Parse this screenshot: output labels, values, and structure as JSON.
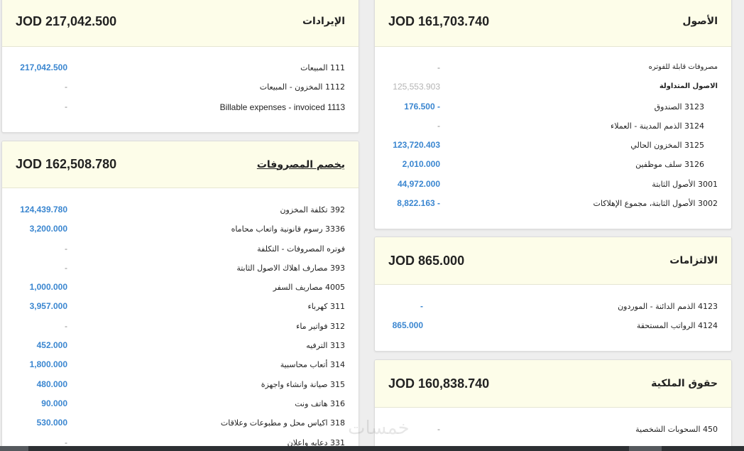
{
  "revenue": {
    "title": "الإيرادات",
    "total": "JOD 217,042.500",
    "rows": [
      {
        "label": "111 المبيعات",
        "value": "217,042.500"
      },
      {
        "label": "1112 المخزون - المبيعات",
        "value": "-"
      },
      {
        "label": "Billable expenses - invoiced 1113",
        "value": "-"
      }
    ]
  },
  "expenses": {
    "title": "يخصم المصروفات",
    "total": "JOD 162,508.780",
    "rows": [
      {
        "label": "392 تكلفة المخزون",
        "value": "124,439.780"
      },
      {
        "label": "3336 رسوم قانونية واتعاب محاماه",
        "value": "3,200.000"
      },
      {
        "label": "فوتره المصروفات - التكلفة",
        "value": "-"
      },
      {
        "label": "393 مصارف اهلاك الاصول الثابتة",
        "value": "-"
      },
      {
        "label": "4005 مصاريف السفر",
        "value": "1,000.000"
      },
      {
        "label": "311 كهرباء",
        "value": "3,957.000"
      },
      {
        "label": "312 فواتير ماء",
        "value": "-"
      },
      {
        "label": "313 الترفيه",
        "value": "452.000"
      },
      {
        "label": "314 أتعاب محاسبية",
        "value": "1,800.000"
      },
      {
        "label": "315 صيانة وانشاء واجهزة",
        "value": "480.000"
      },
      {
        "label": "316 هاتف ونت",
        "value": "90.000"
      },
      {
        "label": "318 اكياس محل و مطبوعات وعلاقات",
        "value": "530.000"
      },
      {
        "label": "331 دعايه واعلان",
        "value": "-"
      }
    ]
  },
  "assets": {
    "title": "الأصول",
    "total": "JOD 161,703.740",
    "rows": [
      {
        "label": "مصروفات قابلة للفوتره",
        "value": "-"
      },
      {
        "label": "الاصول المتداولة",
        "value": "125,553.903"
      },
      {
        "label": "3123 الصندوق",
        "value": "176.500 -"
      },
      {
        "label": "3124 الذمم المدينة - العملاء",
        "value": "-"
      },
      {
        "label": "3125 المخزون الحالي",
        "value": "123,720.403"
      },
      {
        "label": "3126 سلف موظفين",
        "value": "2,010.000"
      },
      {
        "label": "3001 الأصول الثابتة",
        "value": "44,972.000"
      },
      {
        "label": "3002 الأصول الثابتة، مجموع الإهلاكات",
        "value": "8,822.163 -"
      }
    ]
  },
  "liabilities": {
    "title": "الالتزامات",
    "total": "JOD 865.000",
    "rows": [
      {
        "label": "4123 الذمم الدائنة - الموردون",
        "value": "-"
      },
      {
        "label": "4124 الرواتب المستحقة",
        "value": "865.000"
      }
    ]
  },
  "equity": {
    "title": "حقوق الملكية",
    "total": "JOD 160,838.740",
    "rows": [
      {
        "label": "450 السحوبات الشخصية",
        "value": "-"
      }
    ]
  },
  "watermark": "خمسات",
  "colors": {
    "link": "#3a86d0",
    "header_bg": "#fdfde9",
    "muted": "#b5b5b5"
  }
}
